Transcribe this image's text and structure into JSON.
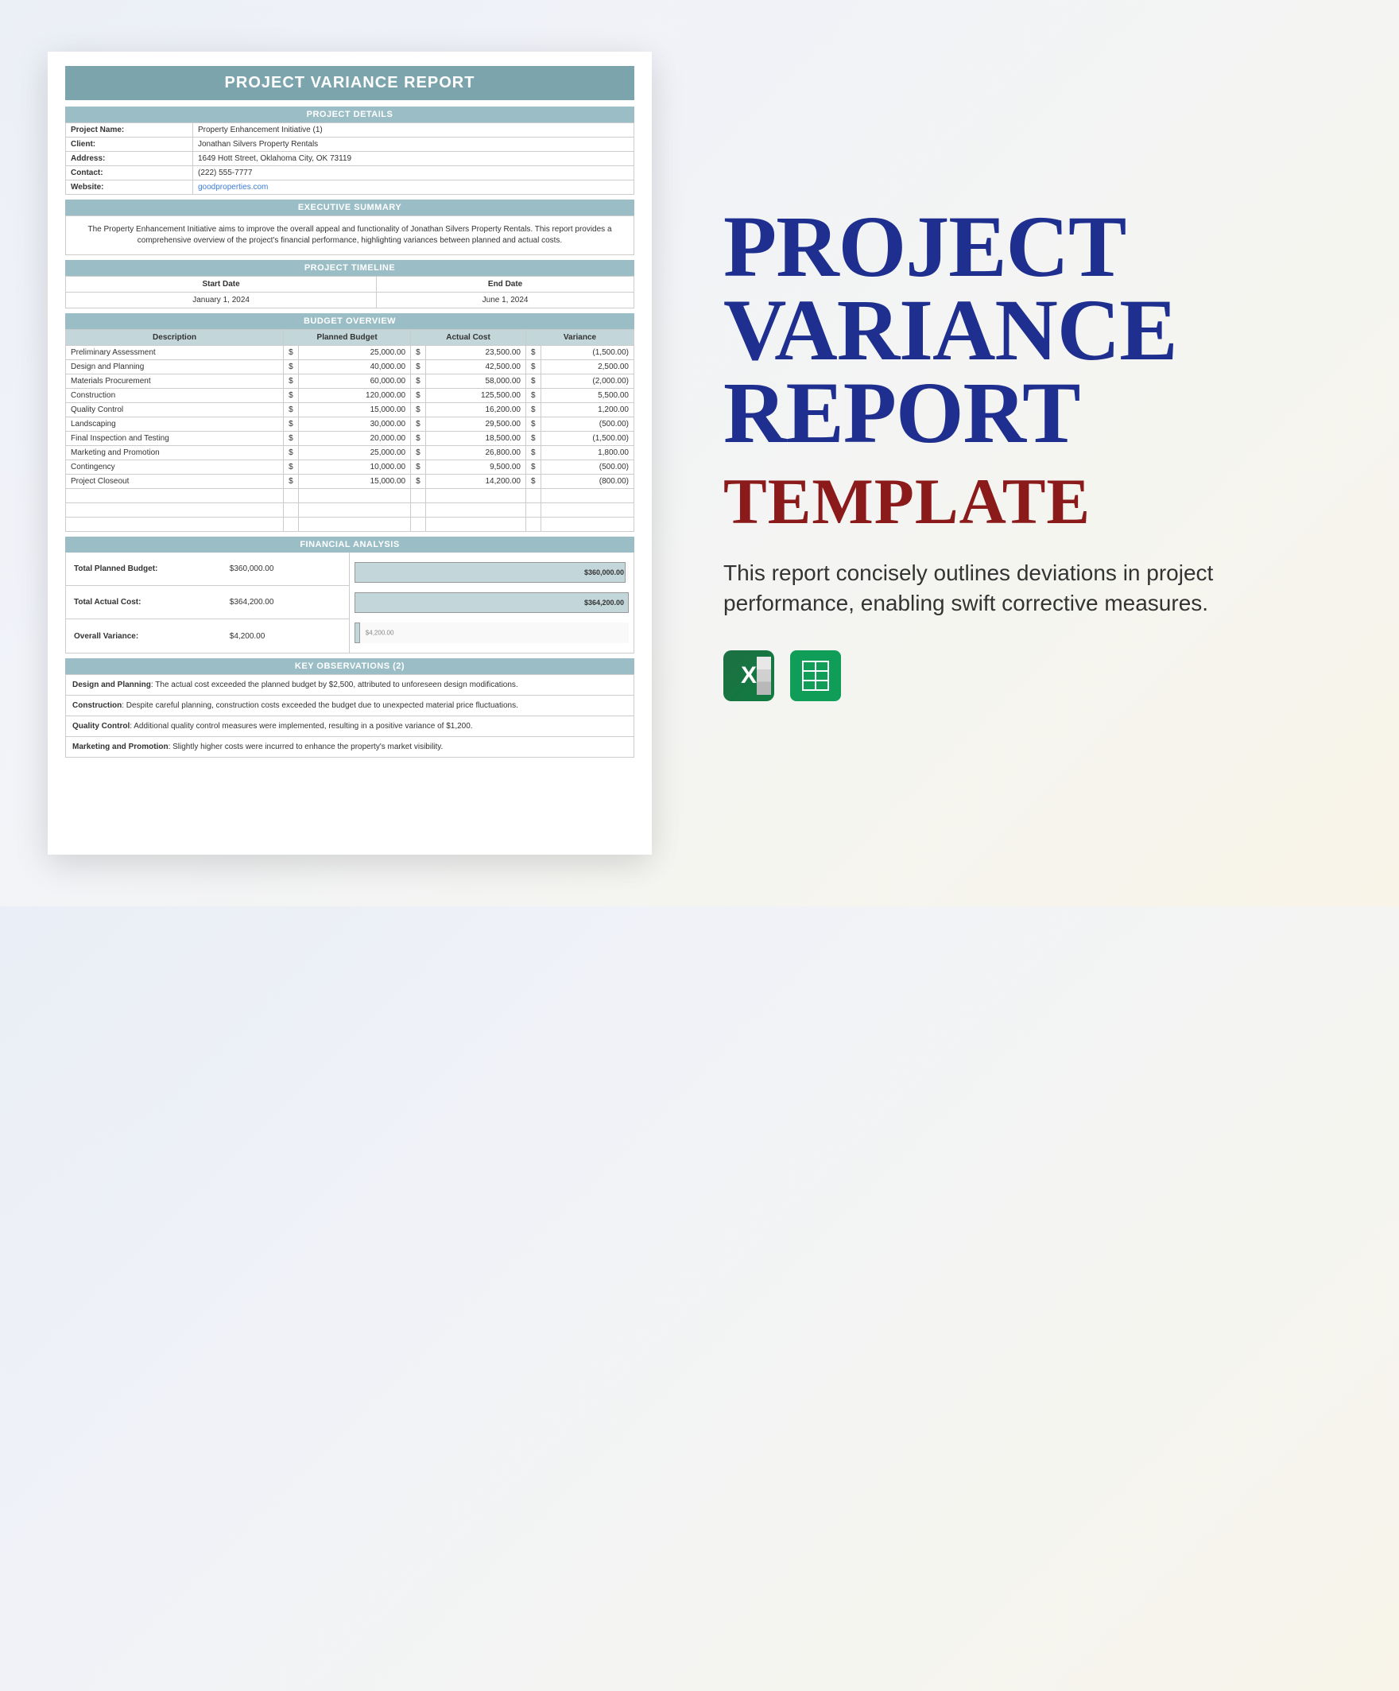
{
  "doc": {
    "title": "PROJECT VARIANCE REPORT",
    "sections": {
      "project_details": "PROJECT DETAILS",
      "executive_summary": "EXECUTIVE SUMMARY",
      "project_timeline": "PROJECT TIMELINE",
      "budget_overview": "BUDGET OVERVIEW",
      "financial_analysis": "FINANCIAL ANALYSIS",
      "key_observations": "KEY OBSERVATIONS (2)"
    },
    "details": {
      "project_name_label": "Project Name:",
      "project_name": "Property Enhancement Initiative (1)",
      "client_label": "Client:",
      "client": "Jonathan Silvers Property Rentals",
      "address_label": "Address:",
      "address": "1649 Hott Street, Oklahoma City, OK 73119",
      "contact_label": "Contact:",
      "contact": "(222) 555-7777",
      "website_label": "Website:",
      "website": "goodproperties.com"
    },
    "executive_summary": "The Property Enhancement Initiative aims to improve the overall appeal and functionality of Jonathan Silvers Property Rentals. This report provides a comprehensive overview of the project's financial performance, highlighting variances between planned and actual costs.",
    "timeline": {
      "start_label": "Start Date",
      "end_label": "End Date",
      "start": "January 1, 2024",
      "end": "June 1, 2024"
    },
    "budget_headers": {
      "description": "Description",
      "planned": "Planned Budget",
      "actual": "Actual Cost",
      "variance": "Variance"
    },
    "budget_rows": [
      {
        "desc": "Preliminary Assessment",
        "planned": "25,000.00",
        "actual": "23,500.00",
        "variance": "(1,500.00)"
      },
      {
        "desc": "Design and Planning",
        "planned": "40,000.00",
        "actual": "42,500.00",
        "variance": "2,500.00"
      },
      {
        "desc": "Materials Procurement",
        "planned": "60,000.00",
        "actual": "58,000.00",
        "variance": "(2,000.00)"
      },
      {
        "desc": "Construction",
        "planned": "120,000.00",
        "actual": "125,500.00",
        "variance": "5,500.00"
      },
      {
        "desc": "Quality Control",
        "planned": "15,000.00",
        "actual": "16,200.00",
        "variance": "1,200.00"
      },
      {
        "desc": "Landscaping",
        "planned": "30,000.00",
        "actual": "29,500.00",
        "variance": "(500.00)"
      },
      {
        "desc": "Final Inspection and Testing",
        "planned": "20,000.00",
        "actual": "18,500.00",
        "variance": "(1,500.00)"
      },
      {
        "desc": "Marketing and Promotion",
        "planned": "25,000.00",
        "actual": "26,800.00",
        "variance": "1,800.00"
      },
      {
        "desc": "Contingency",
        "planned": "10,000.00",
        "actual": "9,500.00",
        "variance": "(500.00)"
      },
      {
        "desc": "Project Closeout",
        "planned": "15,000.00",
        "actual": "14,200.00",
        "variance": "(800.00)"
      }
    ],
    "currency": "$",
    "financial": {
      "planned_label": "Total Planned Budget:",
      "planned": "$360,000.00",
      "actual_label": "Total Actual Cost:",
      "actual": "$364,200.00",
      "variance_label": "Overall Variance:",
      "variance": "$4,200.00"
    },
    "observations": [
      {
        "title": "Design and Planning",
        "text": ": The actual cost exceeded the planned budget by $2,500, attributed to unforeseen design modifications."
      },
      {
        "title": "Construction",
        "text": ": Despite careful planning, construction costs exceeded the budget due to unexpected material price fluctuations."
      },
      {
        "title": "Quality Control",
        "text": ": Additional quality control measures were implemented, resulting in a positive variance of $1,200."
      },
      {
        "title": "Marketing and Promotion",
        "text": ": Slightly higher costs were incurred to enhance the property's market visibility."
      }
    ]
  },
  "promo": {
    "title_line1": "PROJECT",
    "title_line2": "VARIANCE",
    "title_line3": "REPORT",
    "subtitle": "TEMPLATE",
    "description": "This report concisely outlines deviations in project performance, enabling swift corrective measures."
  },
  "chart_data": {
    "type": "bar",
    "categories": [
      "Total Planned Budget",
      "Total Actual Cost",
      "Overall Variance"
    ],
    "values": [
      360000,
      364200,
      4200
    ],
    "labels": [
      "$360,000.00",
      "$364,200.00",
      "$4,200.00"
    ],
    "max": 364200,
    "title": "Financial Analysis",
    "xlabel": "",
    "ylabel": ""
  }
}
